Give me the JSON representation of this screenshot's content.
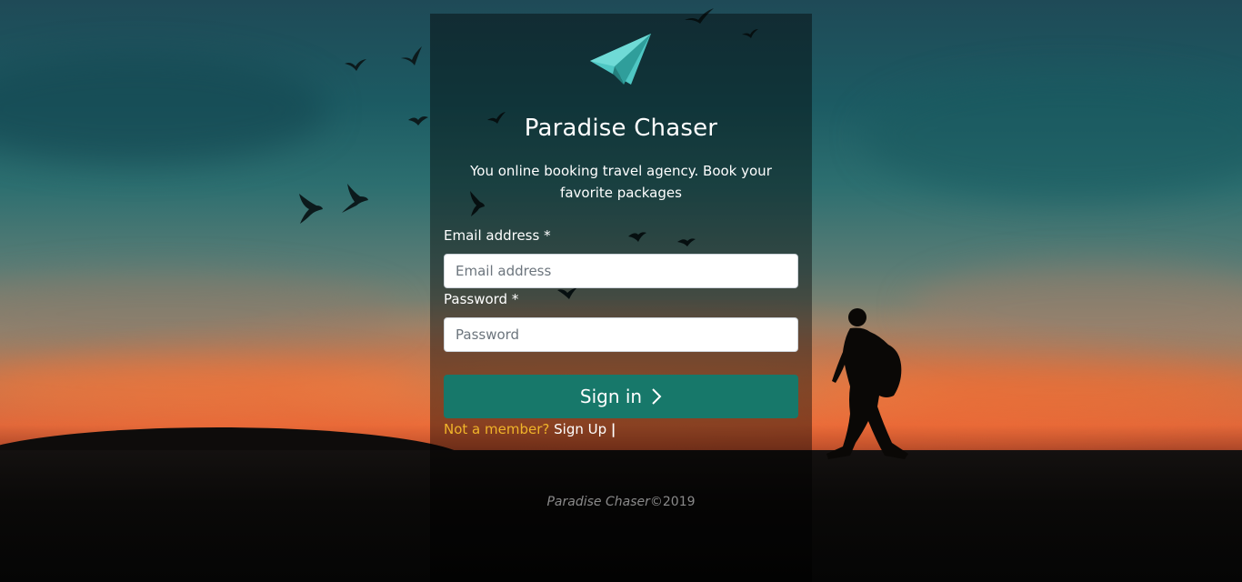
{
  "brand": {
    "title": "Paradise Chaser",
    "tagline": "You online booking travel agency. Book your favorite packages",
    "logo_icon": "paper-plane-icon"
  },
  "form": {
    "email_label": "Email address *",
    "email_placeholder": "Email address",
    "email_value": "",
    "password_label": "Password *",
    "password_placeholder": "Password",
    "password_value": "",
    "signin_label": "Sign in",
    "signin_icon": "chevron-right-icon"
  },
  "signup": {
    "question": "Not a member?",
    "link_label": "Sign Up",
    "separator": "|"
  },
  "footer": {
    "brand": "Paradise Chaser",
    "copyright": "©2019"
  },
  "colors": {
    "accent": "#17786a",
    "logo": "#4fc7c4",
    "question": "#f0b42a"
  }
}
